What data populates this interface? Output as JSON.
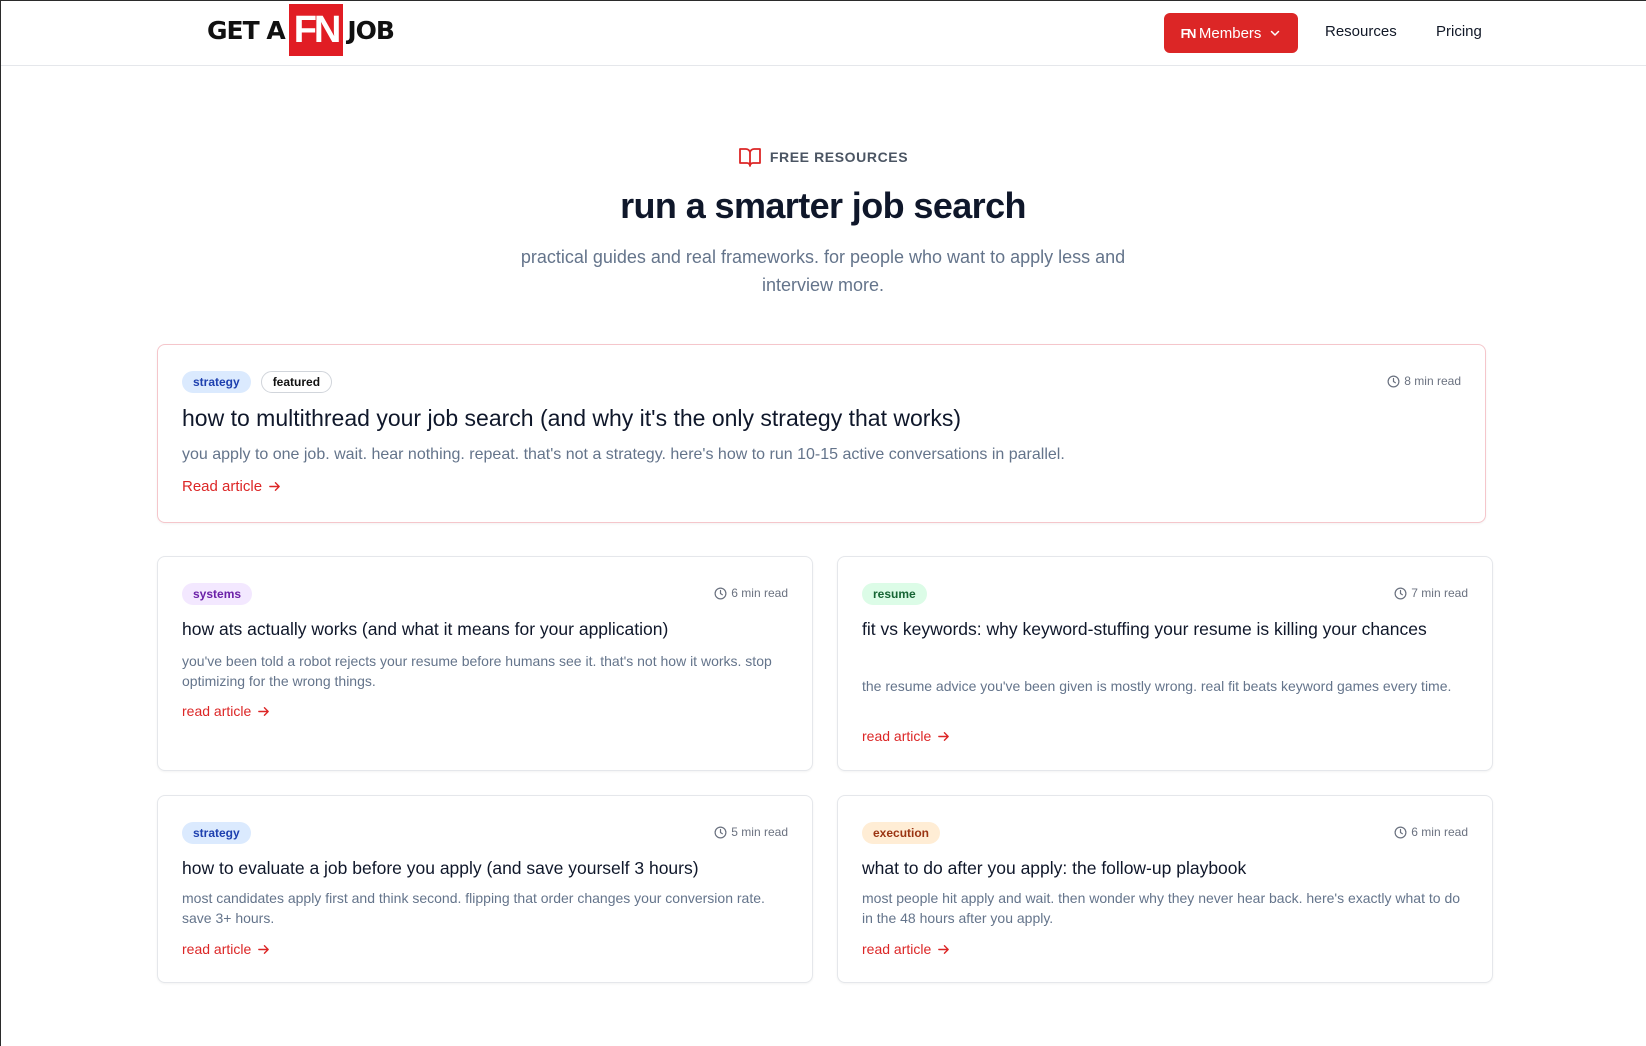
{
  "header": {
    "logo": {
      "left": "GET A",
      "mid": "FN",
      "right": "JOB"
    },
    "members_button": {
      "badge": "FN",
      "label": "Members"
    },
    "nav": [
      {
        "label": "Resources"
      },
      {
        "label": "Pricing"
      }
    ]
  },
  "hero": {
    "eyebrow": "FREE RESOURCES",
    "title": "run a smarter job search",
    "subtitle": "practical guides and real frameworks. for people who want to apply less and interview more."
  },
  "featured": {
    "tags": [
      "strategy",
      "featured"
    ],
    "read_time": "8 min read",
    "title": "how to multithread your job search (and why it's the only strategy that works)",
    "description": "you apply to one job. wait. hear nothing. repeat. that's not a strategy. here's how to run 10-15 active conversations in parallel.",
    "link": "Read article"
  },
  "articles": [
    {
      "tag": "systems",
      "read_time": "6 min read",
      "title": "how ats actually works (and what it means for your application)",
      "description": "you've been told a robot rejects your resume before humans see it. that's not how it works. stop optimizing for the wrong things.",
      "link": "read article"
    },
    {
      "tag": "resume",
      "read_time": "7 min read",
      "title": "fit vs keywords: why keyword-stuffing your resume is killing your chances",
      "description": "the resume advice you've been given is mostly wrong. real fit beats keyword games every time.",
      "link": "read article"
    },
    {
      "tag": "strategy",
      "read_time": "5 min read",
      "title": "how to evaluate a job before you apply (and save yourself 3 hours)",
      "description": "most candidates apply first and think second. flipping that order changes your conversion rate. save 3+ hours.",
      "link": "read article"
    },
    {
      "tag": "execution",
      "read_time": "6 min read",
      "title": "what to do after you apply: the follow-up playbook",
      "description": "most people hit apply and wait. then wonder why they never hear back. here's exactly what to do in the 48 hours after you apply.",
      "link": "read article"
    }
  ],
  "colors": {
    "accent": "#dc2626",
    "muted": "#64748b"
  }
}
